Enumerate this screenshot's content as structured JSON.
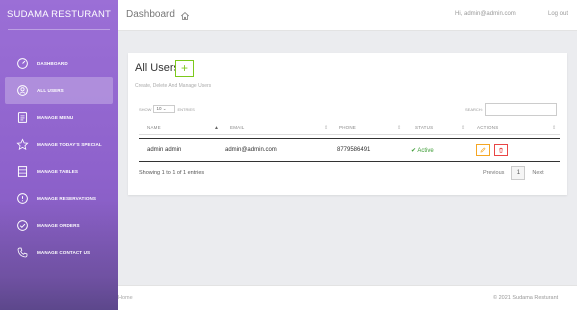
{
  "app": {
    "brand": "SUDAMA RESTURANT"
  },
  "sidebar": {
    "items": [
      {
        "label": "DASHBOARD",
        "icon": "dashboard-icon"
      },
      {
        "label": "ALL USERS",
        "icon": "users-icon",
        "active": true
      },
      {
        "label": "MANAGE MENU",
        "icon": "menu-icon"
      },
      {
        "label": "MANAGE TODAY'S SPECIAL",
        "icon": "star-icon"
      },
      {
        "label": "MANAGE TABLES",
        "icon": "table-icon"
      },
      {
        "label": "MANAGE RESERVATIONS",
        "icon": "reservation-icon"
      },
      {
        "label": "MANAGE ORDERS",
        "icon": "check-circle-icon"
      },
      {
        "label": "MANAGE CONTACT US",
        "icon": "phone-icon"
      }
    ]
  },
  "header": {
    "title": "Dashboard",
    "greeting": "Hi, admin@admin.com",
    "logout": "Log out"
  },
  "main": {
    "title": "All Users",
    "add_label": "+",
    "subtitle": "Create, Delete And Manage Users",
    "show_label": "SHOW",
    "entries_value": "10",
    "entries_label": "ENTRIES",
    "search_label": "SEARCH:",
    "search_value": "",
    "columns": [
      "NAME",
      "EMAIL",
      "PHONE",
      "STATUS",
      "ACTIONS"
    ],
    "rows": [
      {
        "name": "admin admin",
        "email": "admin@admin.com",
        "phone": "8779586491",
        "status": "✔ Active"
      }
    ],
    "edit_icon": "edit-icon",
    "delete_icon": "trash-icon",
    "info": "Showing 1 to 1 of 1 entries",
    "pager": {
      "prev": "Previous",
      "page": "1",
      "next": "Next"
    }
  },
  "footer": {
    "home": "Home",
    "copyright": "© 2021 Sudama Resturant"
  },
  "colors": {
    "sidebar": "#8e62cc",
    "add": "#7cc91c",
    "edit": "#f5a623",
    "delete": "#e94545",
    "active_status": "#3e9d37"
  }
}
